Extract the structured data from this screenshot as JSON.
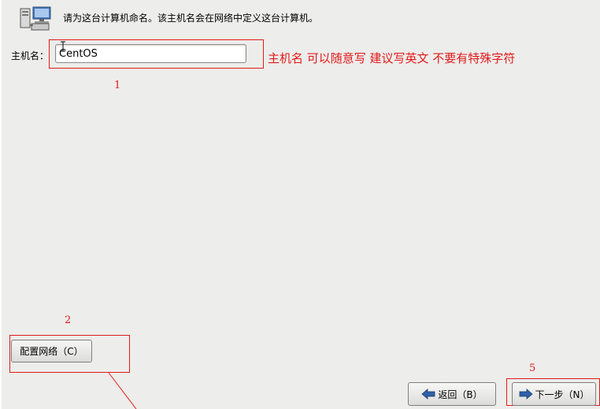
{
  "header": {
    "icon": "network-computers-icon",
    "text": "请为这台计算机命名。该主机名会在网络中定义这台计算机。"
  },
  "hostname": {
    "label": "主机名：",
    "value": "CentOS"
  },
  "annotations": {
    "note_1": "主机名  可以随意写  建议写英文  不要有特殊字符",
    "num_1": "1",
    "num_2": "2",
    "num_5": "5",
    "color": "#e11a1a"
  },
  "buttons": {
    "configure_network": "配置网络（C）",
    "back": "返回（B）",
    "next": "下一步（N）",
    "back_icon": "arrow-left-icon",
    "next_icon": "arrow-right-icon"
  }
}
